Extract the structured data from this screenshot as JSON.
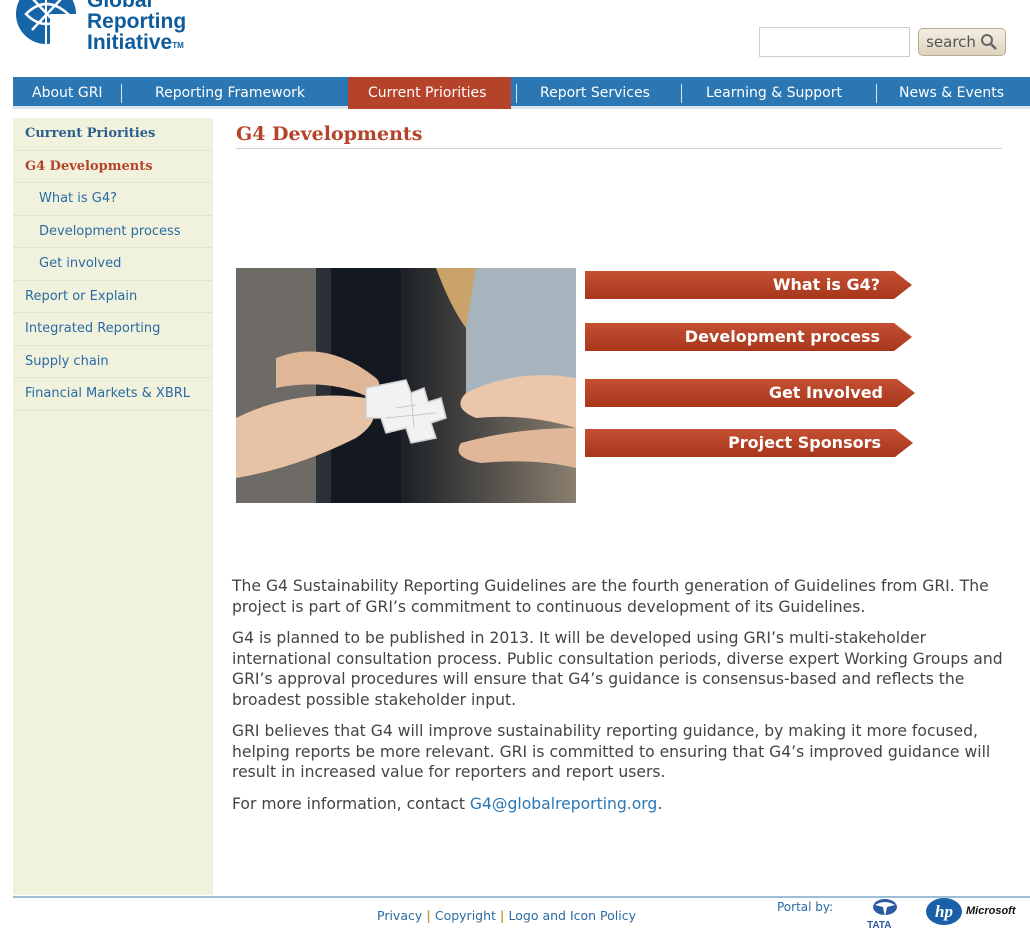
{
  "header": {
    "logo_line1": "Global",
    "logo_line2": "Reporting",
    "logo_line3": "Initiative",
    "logo_tm": "TM",
    "search_value": "",
    "search_button_label": "search",
    "search_icon": "magnifier-icon"
  },
  "nav": {
    "items": [
      {
        "label": "About GRI",
        "active": false
      },
      {
        "label": "Reporting Framework",
        "active": false
      },
      {
        "label": "Current Priorities",
        "active": true
      },
      {
        "label": "Report Services",
        "active": false
      },
      {
        "label": "Learning & Support",
        "active": false
      },
      {
        "label": "News & Events",
        "active": false
      }
    ]
  },
  "sidebar": {
    "items": [
      {
        "label": "Current Priorities"
      },
      {
        "label": "G4 Developments"
      },
      {
        "label": "What is G4?"
      },
      {
        "label": "Development process"
      },
      {
        "label": "Get involved"
      },
      {
        "label": "Report or Explain"
      },
      {
        "label": "Integrated Reporting"
      },
      {
        "label": "Supply chain"
      },
      {
        "label": "Financial Markets & XBRL"
      }
    ]
  },
  "main": {
    "title": "G4 Developments",
    "buttons": [
      {
        "label": "What is G4?"
      },
      {
        "label": "Development process"
      },
      {
        "label": "Get Involved"
      },
      {
        "label": "Project Sponsors"
      }
    ],
    "paragraphs": [
      "The G4 Sustainability Reporting Guidelines are the fourth generation of Guidelines from GRI. The project is part of GRI’s commitment to continuous development of its Guidelines.",
      "G4 is planned to be published in 2013. It will be developed using GRI’s multi-stakeholder international consultation process. Public consultation periods, diverse expert Working Groups and GRI’s approval procedures will ensure that G4’s guidance is consensus-based and reflects the broadest possible stakeholder input.",
      "GRI believes that G4 will improve sustainability reporting guidance, by making it more focused, helping reports be more relevant. GRI is committed to ensuring that G4’s improved guidance will result in increased value for reporters and report users."
    ],
    "contact_prefix": "For more information, contact ",
    "contact_email": "G4@globalreporting.org",
    "contact_suffix": "."
  },
  "footer": {
    "links": [
      {
        "label": "Privacy"
      },
      {
        "label": "Copyright"
      },
      {
        "label": "Logo and Icon Policy"
      }
    ],
    "portal_label": "Portal by:",
    "tata_label": "TATA",
    "hp_label": "hp",
    "microsoft_label": "Microsoft"
  },
  "colors": {
    "nav_blue": "#2a77b4",
    "accent_red": "#b5432a",
    "sidebar_bg": "#f1f2dd"
  }
}
